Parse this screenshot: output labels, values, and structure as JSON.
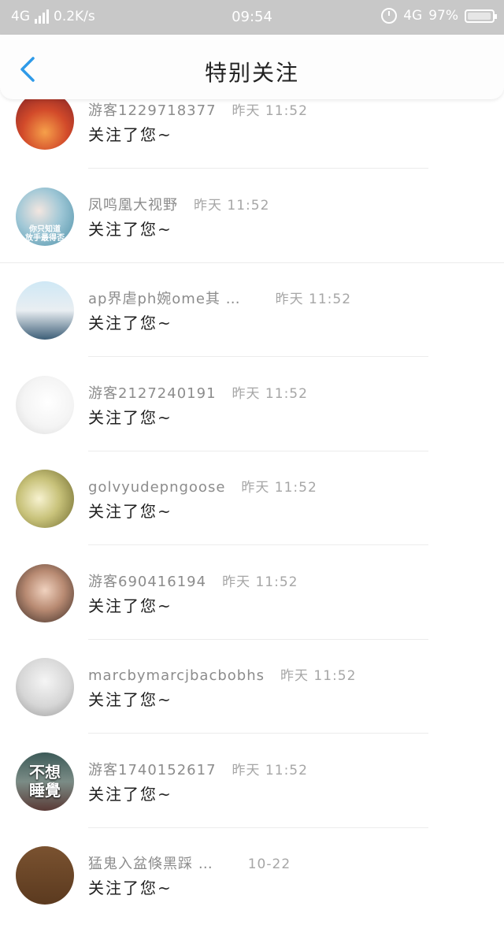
{
  "status_bar": {
    "network": "4G",
    "speed": "0.2K/s",
    "time": "09:54",
    "network_right": "4G",
    "battery": "97%",
    "battery_level": 0.97
  },
  "header": {
    "title": "特别关注"
  },
  "items": [
    {
      "nickname": "游客1229718377",
      "time": "昨天 11:52",
      "action": "关注了您~"
    },
    {
      "nickname": "凤鸣凰大视野",
      "time": "昨天 11:52",
      "action": "关注了您~"
    },
    {
      "nickname": "ap界虐ph婉ome其 …",
      "time": "昨天 11:52",
      "action": "关注了您~"
    },
    {
      "nickname": "游客2127240191",
      "time": "昨天 11:52",
      "action": "关注了您~"
    },
    {
      "nickname": "golvyudepngoose",
      "time": "昨天 11:52",
      "action": "关注了您~"
    },
    {
      "nickname": "游客690416194",
      "time": "昨天 11:52",
      "action": "关注了您~"
    },
    {
      "nickname": "marcbymarcjbacbobhs",
      "time": "昨天 11:52",
      "action": "关注了您~"
    },
    {
      "nickname": "游客1740152617",
      "time": "昨天 11:52",
      "action": "关注了您~"
    },
    {
      "nickname": "猛鬼入盆倏黑踩 …",
      "time": "10-22",
      "action": "关注了您~"
    }
  ],
  "avatar_images": {
    "1": {
      "line1": "你只知道",
      "line2": "放手最得否"
    },
    "7": {
      "line1": "不想",
      "line2": "睡覺"
    }
  },
  "colors": {
    "status_bar_bg": "#c8c8c8",
    "accent_blue": "#2e9ae8",
    "nickname_gray": "#8c8c8c",
    "text_dark": "#222222"
  }
}
